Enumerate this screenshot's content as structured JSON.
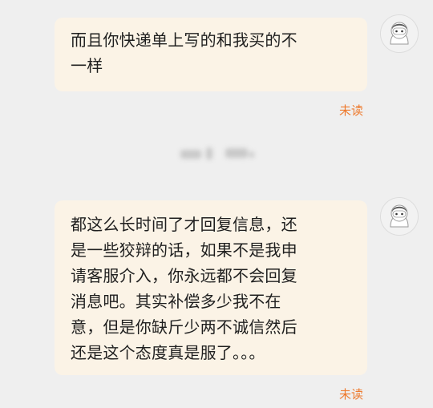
{
  "messages": [
    {
      "text_lines": [
        "而且你快递单上写的和我买的不",
        "一样"
      ],
      "status": "未读"
    },
    {
      "text_lines": [
        "都这么长时间了才回复信息，还",
        "是一些狡辩的话，如果不是我申",
        "请客服介入，你永远都不会回复",
        "消息吧。其实补偿多少我不在",
        "意，但是你缺斤少两不诚信然后",
        "还是这个态度真是服了。。。"
      ],
      "status": "未读"
    }
  ],
  "colors": {
    "background": "#efefef",
    "bubble": "#fbf3e6",
    "unread": "#ee7a2d"
  },
  "avatar_icon": "astronaut-avatar-icon"
}
